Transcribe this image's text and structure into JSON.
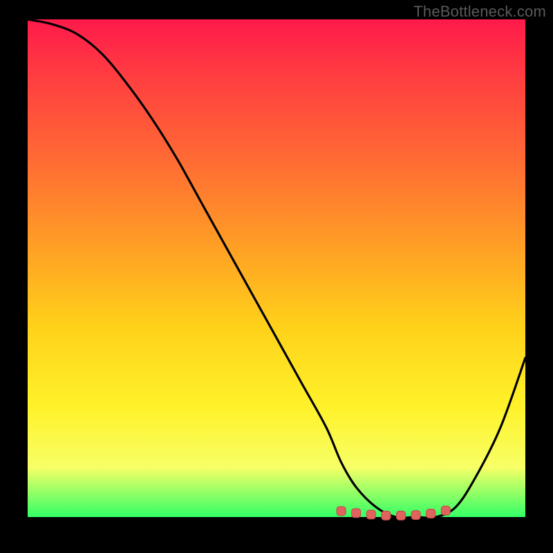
{
  "watermark": "TheBottleneck.com",
  "colors": {
    "background": "#000000",
    "gradient_top": "#ff1a4a",
    "gradient_bottom": "#33ff66",
    "curve": "#000000",
    "marker_fill": "#e0635e",
    "marker_stroke": "#c04545"
  },
  "chart_data": {
    "type": "line",
    "title": "",
    "xlabel": "",
    "ylabel": "",
    "xlim": [
      0,
      100
    ],
    "ylim": [
      0,
      100
    ],
    "grid": false,
    "series": [
      {
        "name": "bottleneck-curve",
        "x": [
          0,
          5,
          10,
          15,
          20,
          25,
          30,
          35,
          40,
          45,
          50,
          55,
          60,
          63,
          66,
          70,
          74,
          78,
          82,
          86,
          90,
          95,
          100
        ],
        "y": [
          100,
          99,
          97,
          93,
          87,
          80,
          72,
          63,
          54,
          45,
          36,
          27,
          18,
          11,
          6,
          2,
          0,
          0,
          0,
          2,
          8,
          18,
          32
        ]
      }
    ],
    "markers": {
      "name": "highlight-range",
      "x": [
        63,
        66,
        69,
        72,
        75,
        78,
        81,
        84
      ],
      "y": [
        1.2,
        0.8,
        0.5,
        0.3,
        0.3,
        0.4,
        0.7,
        1.3
      ]
    }
  }
}
